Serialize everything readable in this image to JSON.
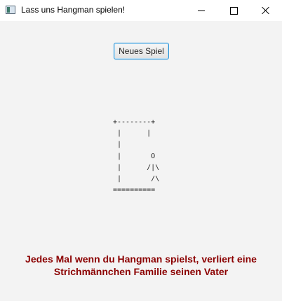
{
  "window": {
    "title": "Lass uns Hangman spielen!",
    "icon": "app-window-icon",
    "controls": [
      "minimize-icon",
      "maximize-icon",
      "close-icon"
    ]
  },
  "toolbar": {
    "new_game_label": "Neues Spiel"
  },
  "game": {
    "hangman_art": "+--------+\n |      |\n |\n |       O\n |      /|\\\n |       /\\\n=========="
  },
  "footer": {
    "message_line1": "Jedes Mal wenn du Hangman spielst, verliert eine",
    "message_line2": "Strichmännchen Familie seinen Vater"
  },
  "colors": {
    "message": "#8b0000",
    "button_border": "#2b93d6",
    "background": "#f3f3f3"
  }
}
